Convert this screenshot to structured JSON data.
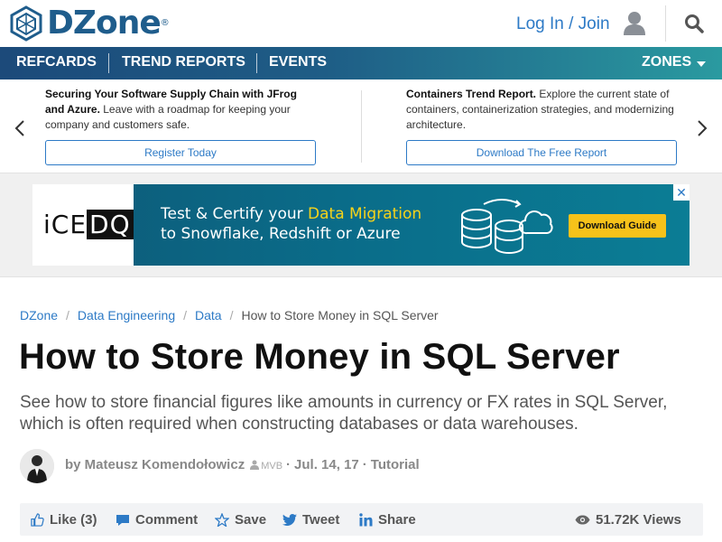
{
  "brand": {
    "name": "DZone",
    "reg": "®",
    "accent": "#1f5d8c",
    "link": "#2d7ac6"
  },
  "header": {
    "login_label": "Log In / Join",
    "user_icon": "user-icon",
    "search_icon": "search-icon"
  },
  "nav": {
    "items": [
      {
        "label": "REFCARDS"
      },
      {
        "label": "TREND REPORTS"
      },
      {
        "label": "EVENTS"
      }
    ],
    "zones_label": "ZONES"
  },
  "promo": {
    "left": {
      "bold": "Securing Your Software Supply Chain with JFrog and Azure.",
      "text": " Leave with a roadmap for keeping your company and customers safe.",
      "button": "Register Today"
    },
    "right": {
      "bold": "Containers Trend Report.",
      "text": " Explore the current state of containers, containerization strategies, and modernizing architecture.",
      "button": "Download The Free Report"
    }
  },
  "ad": {
    "logo_a": "iCE",
    "logo_b": "DQ",
    "line1_a": "Test & Certify your ",
    "line1_hl": "Data Migration",
    "line2": "to Snowflake, Redshift or Azure",
    "cta": "Download Guide",
    "close": "✕"
  },
  "breadcrumb": {
    "items": [
      "DZone",
      "Data Engineering",
      "Data"
    ],
    "current": "How to Store Money in SQL Server"
  },
  "article": {
    "title": "How to Store Money in SQL Server",
    "subtitle": "See how to store financial figures like amounts in currency or FX rates in SQL Server, which is often required when constructing databases or data warehouses.",
    "by": "by Mateusz Komendołowicz",
    "badge": "MVB",
    "date": "Jul. 14, 17",
    "type": "Tutorial"
  },
  "actions": {
    "like": "Like (3)",
    "comment": "Comment",
    "save": "Save",
    "tweet": "Tweet",
    "share": "Share",
    "views": "51.72K Views"
  }
}
